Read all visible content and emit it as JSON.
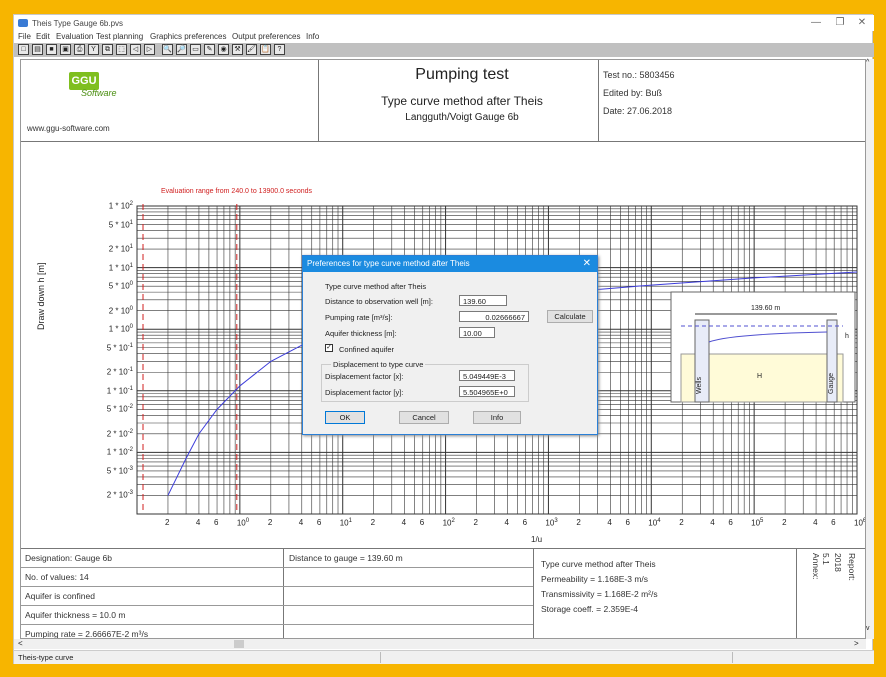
{
  "window": {
    "title": "Theis Type Gauge 6b.pvs",
    "minimize": "—",
    "restore": "❐",
    "close": "✕"
  },
  "menu": [
    "File",
    "Edit",
    "Evaluation",
    "Test planning",
    "Graphics preferences",
    "Output preferences",
    "Info"
  ],
  "toolbar_icons": [
    "new-icon",
    "open-icon",
    "save-icon",
    "save-as-icon",
    "print-icon",
    "y-icon",
    "copy-icon",
    "select-icon",
    "undo-icon",
    "redo-icon",
    "zoom-in-icon",
    "zoom-out-icon",
    "window-icon",
    "pen-icon",
    "coin-icon",
    "tools-icon",
    "paint-icon",
    "paste-icon",
    "help-icon"
  ],
  "toolbar_glyphs": [
    "□",
    "▤",
    "■",
    "▣",
    "⎙",
    "Y",
    "⧉",
    "⬚",
    "◁",
    "▷",
    "🔍",
    "🔎",
    "▭",
    "✎",
    "◉",
    "⚒",
    "🖌",
    "📋",
    "?"
  ],
  "header": {
    "logo": "GGU",
    "logo_sub": "Software",
    "website": "www.ggu-software.com",
    "title": "Pumping test",
    "subtitle": "Type curve method after Theis",
    "subtitle2": "Langguth/Voigt Gauge 6b",
    "test_no": "Test no.: 5803456",
    "edited_by": "Edited by: Buß",
    "date": "Date: 27.06.2018"
  },
  "chart_data": {
    "type": "line",
    "eval_range": "Evaluation range from 240.0 to 13900.0 seconds",
    "ylabel": "Draw down h [m]",
    "xlabel": "1/u",
    "yticks": [
      "1 * 10",
      "5 * 10",
      "2 * 10",
      "1 * 10",
      "5 * 10",
      "2 * 10",
      "1 * 10",
      "5 * 10",
      "2 * 10",
      "1 * 10",
      "5 * 10",
      "2 * 10",
      "1 * 10",
      "5 * 10",
      "2 * 10"
    ],
    "yexp": [
      "2",
      "1",
      "1",
      "1",
      "0",
      "0",
      "0",
      "-1",
      "-1",
      "-1",
      "-2",
      "-2",
      "-2",
      "-3",
      "-3"
    ],
    "xticks": [
      "2",
      "4",
      "6",
      "10",
      "2",
      "4",
      "6",
      "10",
      "2",
      "4",
      "6",
      "10",
      "2",
      "4",
      "6",
      "10",
      "2",
      "4",
      "6",
      "10",
      "2",
      "4",
      "6",
      "10",
      "2",
      "4",
      "6",
      "10",
      "2",
      "4",
      "6",
      "10"
    ],
    "xexp": [
      "0",
      "1",
      "2",
      "3",
      "4",
      "5",
      "6",
      "7"
    ],
    "x_range": [
      1,
      10000000
    ],
    "y_range": [
      0.001,
      100
    ],
    "log_scale": true,
    "series": [
      {
        "x": [
          2,
          3,
          4,
          6,
          10,
          20,
          40,
          100,
          300,
          1000,
          3000,
          10000,
          100000,
          1000000,
          10000000
        ],
        "values": [
          0.002,
          0.008,
          0.02,
          0.05,
          0.12,
          0.3,
          0.55,
          1.0,
          1.6,
          2.3,
          3.0,
          3.8,
          5.2,
          6.8,
          8.5
        ]
      }
    ],
    "eval_lines_x": [
      240,
      13900
    ],
    "inset": {
      "distance": "139.60 m",
      "label_wells": "Wells",
      "label_gauge": "Gauge",
      "label_H": "H",
      "label_h": "h"
    }
  },
  "dialog": {
    "title": "Preferences for type curve method after Theis",
    "heading": "Type curve method after Theis",
    "dist_label": "Distance to observation well [m]:",
    "dist_value": "139.60",
    "rate_label": "Pumping rate [m³/s]:",
    "rate_value": "0.02666667",
    "calc_btn": "Calculate",
    "thick_label": "Aquifer thickness [m]:",
    "thick_value": "10.00",
    "confined_label": "Confined aquifer",
    "confined_checked": "✓",
    "group_label": "Displacement to type curve",
    "dx_label": "Displacement factor [x]:",
    "dx_value": "5.049449E-3",
    "dy_label": "Displacement factor [y]:",
    "dy_value": "5.504965E+0",
    "ok": "OK",
    "cancel": "Cancel",
    "info": "Info"
  },
  "footer": {
    "designation": "Designation: Gauge 6b",
    "values": "No. of values: 14",
    "confined": "Aquifer is confined",
    "thickness": "Aquifer thickness = 10.0 m",
    "rate": "Pumping rate = 2.66667E-2 m³/s",
    "distance": "Distance to gauge = 139.60 m",
    "method": "Type curve method after Theis",
    "permeability": "Permeability = 1.168E-3 m/s",
    "transmissivity": "Transmissivity = 1.168E-2 m²/s",
    "storage": "Storage coeff. = 2.359E-4",
    "annex": "Annex:",
    "annex_no": "5.1",
    "report": "Report:",
    "report_no": "2018"
  },
  "status": {
    "left": "Theis-type curve",
    "scroll_left": "<",
    "scroll_right": ">",
    "scroll_up": "^",
    "scroll_down": "v"
  }
}
